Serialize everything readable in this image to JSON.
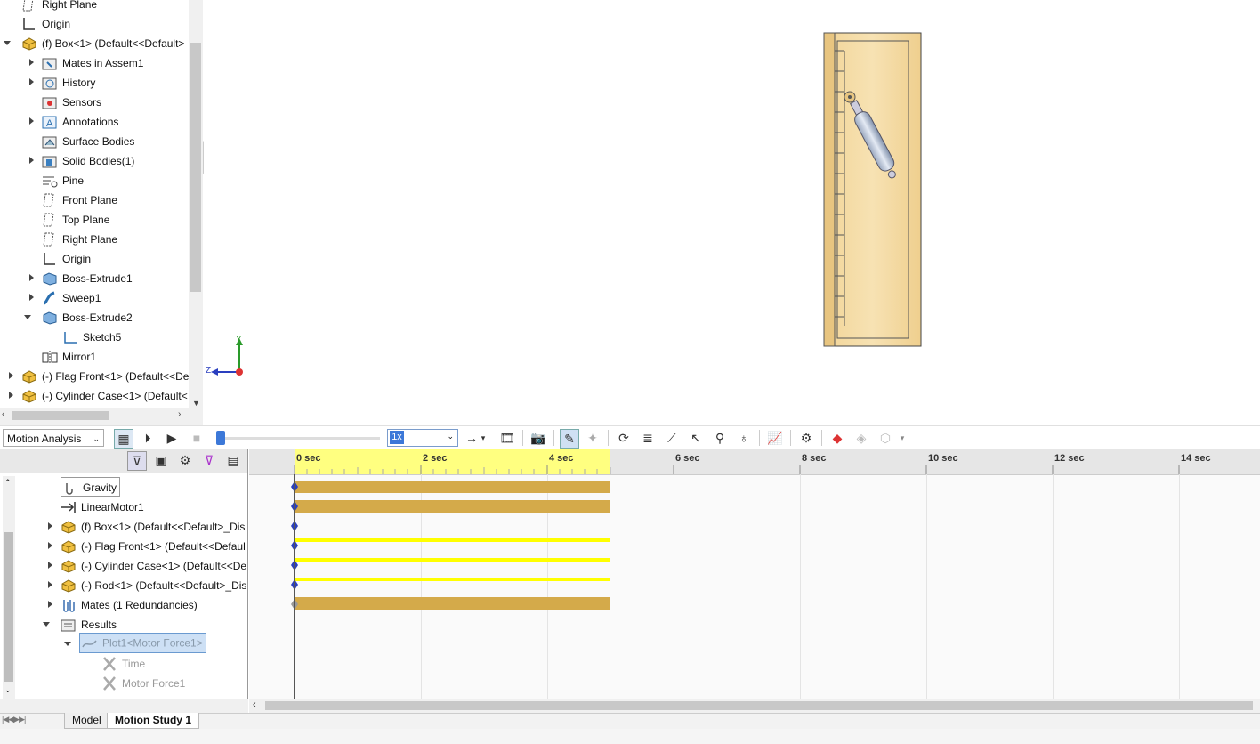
{
  "feature_tree": {
    "items": [
      {
        "label": "Right Plane",
        "icon": "plane-icon"
      },
      {
        "label": "Origin",
        "icon": "origin-icon"
      },
      {
        "label": "(f) Box<1> (Default<<Default>",
        "icon": "part-icon"
      },
      {
        "label": "Mates in Assem1",
        "icon": "mates-folder-icon"
      },
      {
        "label": "History",
        "icon": "history-icon"
      },
      {
        "label": "Sensors",
        "icon": "sensors-icon"
      },
      {
        "label": "Annotations",
        "icon": "annotations-icon"
      },
      {
        "label": "Surface Bodies",
        "icon": "surface-bodies-icon"
      },
      {
        "label": "Solid Bodies(1)",
        "icon": "solid-bodies-icon"
      },
      {
        "label": "Pine",
        "icon": "material-icon"
      },
      {
        "label": "Front Plane",
        "icon": "plane-icon"
      },
      {
        "label": "Top Plane",
        "icon": "plane-icon"
      },
      {
        "label": "Right Plane",
        "icon": "plane-icon"
      },
      {
        "label": "Origin",
        "icon": "origin-icon"
      },
      {
        "label": "Boss-Extrude1",
        "icon": "extrude-icon"
      },
      {
        "label": "Sweep1",
        "icon": "sweep-icon"
      },
      {
        "label": "Boss-Extrude2",
        "icon": "extrude-icon"
      },
      {
        "label": "Sketch5",
        "icon": "sketch-icon"
      },
      {
        "label": "Mirror1",
        "icon": "mirror-icon"
      },
      {
        "label": "(-) Flag Front<1> (Default<<De",
        "icon": "part-icon"
      },
      {
        "label": "(-) Cylinder Case<1> (Default<",
        "icon": "part-icon"
      }
    ]
  },
  "triad": {
    "y": "Y",
    "z": "Z"
  },
  "toolbar": {
    "study_type": "Motion Analysis",
    "speed": "1x"
  },
  "motion_tree": {
    "items": [
      {
        "label": "Gravity",
        "icon": "gravity-icon"
      },
      {
        "label": "LinearMotor1",
        "icon": "linear-motor-icon"
      },
      {
        "label": "(f) Box<1> (Default<<Default>_Dis",
        "icon": "part-icon"
      },
      {
        "label": "(-) Flag Front<1> (Default<<Defaul",
        "icon": "part-icon"
      },
      {
        "label": "(-) Cylinder Case<1> (Default<<De",
        "icon": "part-icon"
      },
      {
        "label": "(-) Rod<1> (Default<<Default>_Dis",
        "icon": "part-icon"
      },
      {
        "label": "Mates (1 Redundancies)",
        "icon": "mates-icon"
      },
      {
        "label": "Results",
        "icon": "results-folder-icon"
      },
      {
        "label": "Plot1<Motor Force1>",
        "icon": "plot-icon"
      },
      {
        "label": "Time",
        "icon": "x-icon"
      },
      {
        "label": "Motor Force1",
        "icon": "x-icon"
      }
    ]
  },
  "timeline": {
    "ticks": [
      "0 sec",
      "2 sec",
      "4 sec",
      "6 sec",
      "8 sec",
      "10 sec",
      "12 sec",
      "14 sec"
    ]
  },
  "tabs": {
    "model": "Model",
    "motion_study": "Motion Study 1"
  },
  "colors": {
    "bar": "#d4aa4a",
    "thin_bar": "#ffff00",
    "ruler_active": "#ffff80",
    "selection": "#cde0f5"
  }
}
